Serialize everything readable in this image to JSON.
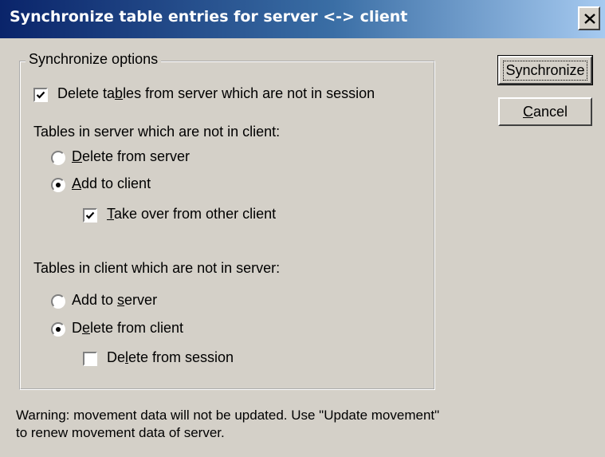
{
  "window": {
    "title": "Synchronize table entries for server <-> client",
    "close_icon": "close-icon"
  },
  "group": {
    "legend": "Synchronize options"
  },
  "options": {
    "delete_tables": {
      "pre": "Delete ta",
      "acc": "b",
      "post": "les from server which are not in session",
      "checked": true
    },
    "server_not_in_client_heading": "Tables in server which are not in client:",
    "delete_from_server": {
      "pre": "",
      "acc": "D",
      "post": "elete from server",
      "selected": false
    },
    "add_to_client": {
      "pre": "",
      "acc": "A",
      "post": "dd to client",
      "selected": true
    },
    "take_over": {
      "pre": "",
      "acc": "T",
      "post": "ake over from other client",
      "checked": true
    },
    "client_not_in_server_heading": "Tables in client which are not in server:",
    "add_to_server": {
      "pre": "Add to ",
      "acc": "s",
      "post": "erver",
      "selected": false
    },
    "delete_from_client": {
      "pre": "D",
      "acc": "e",
      "post": "lete from client",
      "selected": true
    },
    "delete_from_session": {
      "pre": "De",
      "acc": "l",
      "post": "ete from session",
      "checked": false
    }
  },
  "buttons": {
    "synchronize": "Synchronize",
    "cancel": {
      "pre": "",
      "acc": "C",
      "post": "ancel"
    }
  },
  "warning": "Warning: movement data will not be updated. Use \"Update movement\" to renew movement data of server."
}
